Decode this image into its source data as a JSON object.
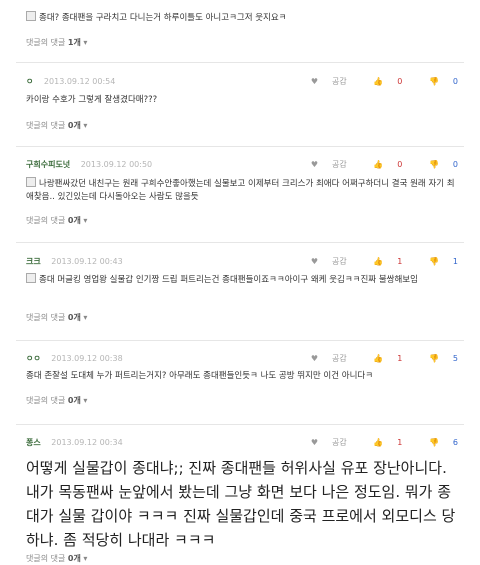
{
  "comments": [
    {
      "author": "",
      "date": "",
      "text": "종대? 종대팬을 구라치고 다니는거 하루이틀도 아니고ㅋ그저 웃지요ㅋ",
      "replies_label": "댓글의 댓글",
      "replies_count": "1개"
    },
    {
      "author": "ㅇ",
      "date": "2013.09.12 00:54",
      "good_label": "공감",
      "up": "0",
      "down": "0",
      "text": "카이랑 수호가 그렇게 잘생겼다매???",
      "replies_label": "댓글의 댓글",
      "replies_count": "0개"
    },
    {
      "author": "구희수피도넛",
      "date": "2013.09.12 00:50",
      "good_label": "공감",
      "up": "0",
      "down": "0",
      "text": "나랑팬싸갔던 내친구는 원래 구희수안좋아했는데 실물보고 이제부터 크리스가 최애다 어쩌구하더니 결국 원래 자기 최애찾음.. 있긴있는데 다시돌아오는 사람도 많을듯",
      "replies_label": "댓글의 댓글",
      "replies_count": "0개"
    },
    {
      "author": "크크",
      "date": "2013.09.12 00:43",
      "good_label": "공감",
      "up": "1",
      "down": "1",
      "text": "종대 머글킹 영업왕 실물갑 인기짱 드립 퍼트리는건 종대팬들이죠ㅋㅋ아이구 왜케 웃김ㅋㅋ진짜 불쌍해보임",
      "replies_label": "댓글의 댓글",
      "replies_count": "0개"
    },
    {
      "author": "ㅇㅇ",
      "date": "2013.09.12 00:38",
      "good_label": "공감",
      "up": "1",
      "down": "5",
      "text": "종대 존잘설 도대체 누가 퍼트리는거지? 아무래도 종대팬들인듯ㅋ 나도 공방 뛰지만 이건 아니다ㅋ",
      "replies_label": "댓글의 댓글",
      "replies_count": "0개"
    },
    {
      "author": "퐁스",
      "date": "2013.09.12 00:34",
      "good_label": "공감",
      "up": "1",
      "down": "6",
      "text": "어떻게 실물갑이 종대냐;; 진짜 종대팬들 허위사실 유포 장난아니다. 내가 목동팬싸 눈앞에서 봤는데 그냥 화면 보다 나은 정도임. 뭐가 종대가 실물 갑이야 ㅋㅋㅋ 진짜 실물갑인데 중국 프로에서 외모디스 당하냐. 좀 적당히 나대라 ㅋㅋㅋ",
      "replies_label": "댓글의 댓글",
      "replies_count": "0개"
    }
  ]
}
